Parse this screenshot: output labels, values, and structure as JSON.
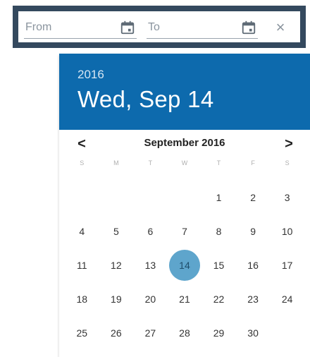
{
  "range": {
    "from_placeholder": "From",
    "to_placeholder": "To",
    "clear_symbol": "×",
    "frame_color": "#34495e"
  },
  "datepicker": {
    "header_color": "#0d6aad",
    "selected_color": "#5ea5cc",
    "year": "2016",
    "date": "Wed, Sep 14",
    "prev_symbol": "<",
    "next_symbol": ">",
    "month_label": "September 2016",
    "weekdays": [
      "S",
      "M",
      "T",
      "W",
      "T",
      "F",
      "S"
    ],
    "weeks": [
      [
        "",
        "",
        "",
        "",
        "1",
        "2",
        "3"
      ],
      [
        "4",
        "5",
        "6",
        "7",
        "8",
        "9",
        "10"
      ],
      [
        "11",
        "12",
        "13",
        "14",
        "15",
        "16",
        "17"
      ],
      [
        "18",
        "19",
        "20",
        "21",
        "22",
        "23",
        "24"
      ],
      [
        "25",
        "26",
        "27",
        "28",
        "29",
        "30",
        ""
      ]
    ],
    "selected_day": "14"
  }
}
